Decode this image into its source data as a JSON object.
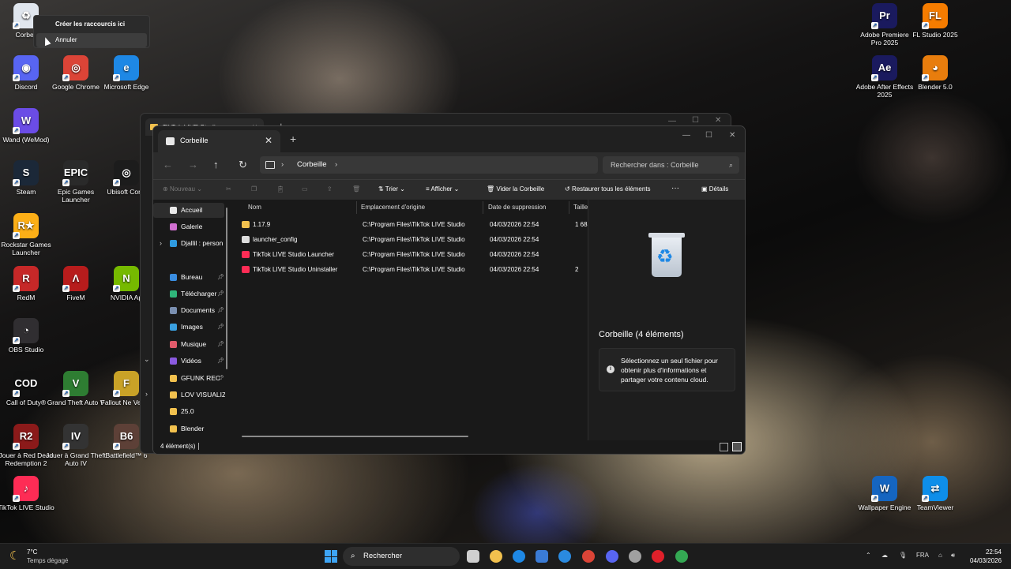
{
  "context_menu": {
    "create_shortcut": "Créer les raccourcis ici",
    "cancel": "Annuler"
  },
  "desktop_icons_left": [
    {
      "label": "Corbeil",
      "color": "#e0e6ee",
      "glyph": "♻"
    },
    {
      "label": "Discord",
      "color": "#5865f2",
      "glyph": "◉"
    },
    {
      "label": "Google Chrome",
      "color": "#db4437",
      "glyph": "◎"
    },
    {
      "label": "Microsoft Edge",
      "color": "#1e88e5",
      "glyph": "e"
    },
    {
      "label": "Wand (WeMod)",
      "color": "#6b4ce6",
      "glyph": "W"
    },
    {
      "label": "Steam",
      "color": "#1b2838",
      "glyph": "S"
    },
    {
      "label": "Epic Games Launcher",
      "color": "#2a2a2a",
      "glyph": "EPIC"
    },
    {
      "label": "Ubisoft Conn",
      "color": "#1c1c1c",
      "glyph": "◎"
    },
    {
      "label": "Rockstar Games Launcher",
      "color": "#fcaf17",
      "glyph": "R★"
    },
    {
      "label": "RedM",
      "color": "#c62828",
      "glyph": "R"
    },
    {
      "label": "FiveM",
      "color": "#b71c1c",
      "glyph": "Λ"
    },
    {
      "label": "NVIDIA Ap",
      "color": "#76b900",
      "glyph": "N"
    },
    {
      "label": "OBS Studio",
      "color": "#302e31",
      "glyph": "◔"
    },
    {
      "label": "Call of Duty®",
      "color": "#111111",
      "glyph": "COD"
    },
    {
      "label": "Grand Theft Auto V",
      "color": "#2e7d32",
      "glyph": "V"
    },
    {
      "label": "Fallout Ne Vegas",
      "color": "#c9a227",
      "glyph": "F"
    },
    {
      "label": "Jouer à Red Dead Redemption 2",
      "color": "#8b1a1a",
      "glyph": "R2"
    },
    {
      "label": "Jouer à Grand Theft Auto IV",
      "color": "#333333",
      "glyph": "IV"
    },
    {
      "label": "Battlefield™ 6",
      "color": "#5d4037",
      "glyph": "B6"
    },
    {
      "label": "TikTok LIVE Studio",
      "color": "#fe2c55",
      "glyph": "♪"
    }
  ],
  "desktop_icons_right": [
    {
      "label": "Adobe Premiere Pro 2025",
      "color": "#1a1a5e",
      "glyph": "Pr"
    },
    {
      "label": "FL Studio 2025",
      "color": "#f57c00",
      "glyph": "FL"
    },
    {
      "label": "Adobe After Effects 2025",
      "color": "#1a1a5e",
      "glyph": "Ae"
    },
    {
      "label": "Blender 5.0",
      "color": "#e87d0d",
      "glyph": "◕"
    },
    {
      "label": "Wallpaper Engine",
      "color": "#1565c0",
      "glyph": "W"
    },
    {
      "label": "TeamViewer",
      "color": "#0e8ee9",
      "glyph": "⇄"
    }
  ],
  "back_window": {
    "tab_title": "TikTok LIVE Studio"
  },
  "window": {
    "tab_title": "Corbeille",
    "breadcrumb": "Corbeille",
    "search_placeholder": "Rechercher dans : Corbeille",
    "toolbar": {
      "new": "Nouveau",
      "sort": "Trier",
      "view": "Afficher",
      "empty": "Vider la Corbeille",
      "restore": "Restaurer tous les éléments",
      "more": "···",
      "details": "Détails"
    },
    "sidebar": [
      {
        "label": "Accueil",
        "color": "#e8e8e8"
      },
      {
        "label": "Galerie",
        "color": "#d06fd0"
      },
      {
        "label": "Djallil : person",
        "color": "#2f9be0"
      },
      {
        "label": "Bureau",
        "color": "#3a8de0"
      },
      {
        "label": "Télécharger",
        "color": "#2fb57a"
      },
      {
        "label": "Documents",
        "color": "#7a8fb0"
      },
      {
        "label": "Images",
        "color": "#3aa0e0"
      },
      {
        "label": "Musique",
        "color": "#e05a6a"
      },
      {
        "label": "Vidéos",
        "color": "#8a5ae0"
      },
      {
        "label": "GFUNK REC",
        "color": "#f2c14e"
      },
      {
        "label": "LOV VISUALIZI",
        "color": "#f2c14e"
      },
      {
        "label": "25.0",
        "color": "#f2c14e"
      },
      {
        "label": "Blender",
        "color": "#f2c14e"
      }
    ],
    "columns": {
      "name": "Nom",
      "origin": "Emplacement d'origine",
      "deleted": "Date de suppression",
      "size": "Taille"
    },
    "files": [
      {
        "name": "1.17.9",
        "origin": "C:\\Program Files\\TikTok LIVE Studio",
        "date": "04/03/2026 22:54",
        "size": "1 68",
        "icon_color": "#f2c14e"
      },
      {
        "name": "launcher_config",
        "origin": "C:\\Program Files\\TikTok LIVE Studio",
        "date": "04/03/2026 22:54",
        "size": "",
        "icon_color": "#dddddd"
      },
      {
        "name": "TikTok LIVE Studio Launcher",
        "origin": "C:\\Program Files\\TikTok LIVE Studio",
        "date": "04/03/2026 22:54",
        "size": "",
        "icon_color": "#fe2c55"
      },
      {
        "name": "TikTok LIVE Studio Uninstaller",
        "origin": "C:\\Program Files\\TikTok LIVE Studio",
        "date": "04/03/2026 22:54",
        "size": "2",
        "icon_color": "#fe2c55"
      }
    ],
    "details_title": "Corbeille (4 éléments)",
    "details_info": "Sélectionnez un seul fichier pour obtenir plus d'informations et partager votre contenu cloud.",
    "status": "4 élément(s)"
  },
  "taskbar": {
    "weather_temp": "7°C",
    "weather_desc": "Temps dégagé",
    "search": "Rechercher",
    "lang": "FRA",
    "time": "22:54",
    "date": "04/03/2026",
    "apps": [
      {
        "name": "task-view",
        "color": "#cfcfcf"
      },
      {
        "name": "file-explorer",
        "color": "#f2c14e"
      },
      {
        "name": "edge",
        "color": "#1e88e5"
      },
      {
        "name": "store",
        "color": "#3a7bd5"
      },
      {
        "name": "mail",
        "color": "#2a8ae0"
      },
      {
        "name": "chrome",
        "color": "#db4437"
      },
      {
        "name": "discord",
        "color": "#5865f2"
      },
      {
        "name": "steam",
        "color": "#a0a0a0"
      },
      {
        "name": "opera",
        "color": "#e0202a"
      },
      {
        "name": "chrome-2",
        "color": "#34a853"
      }
    ]
  }
}
